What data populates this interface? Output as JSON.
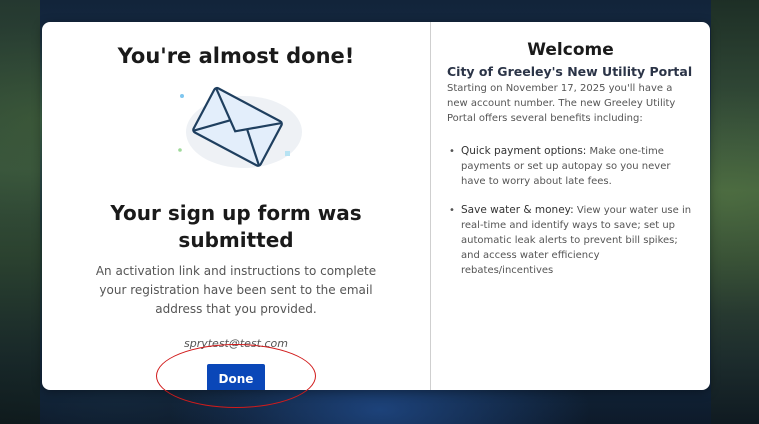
{
  "left": {
    "title": "You're almost done!",
    "submitted_title": "Your sign up form was submitted",
    "activation_text": "An activation link and instructions to complete your registration have been sent to the email address that you provided.",
    "email": "sprytest@test.com",
    "done_label": "Done",
    "envelope_icon": "envelope-icon"
  },
  "right": {
    "title": "Welcome",
    "subtitle": "City of Greeley's New Utility Portal",
    "intro": "Starting on November 17, 2025 you'll have a new account number. The new Greeley Utility Portal offers several benefits including:",
    "benefits": [
      {
        "head": "Quick payment options:",
        "body": " Make one-time payments or set up autopay so you never have to worry about late fees."
      },
      {
        "head": "Save water & money:",
        "body": " View your water use in real-time and identify ways to save; set up automatic leak alerts to prevent bill spikes; and access water efficiency rebates/incentives"
      }
    ]
  },
  "colors": {
    "button": "#0a47b8",
    "annotation": "#d11b1b",
    "envelope_fill": "#e3eefb",
    "envelope_stroke": "#1f3f5f"
  }
}
